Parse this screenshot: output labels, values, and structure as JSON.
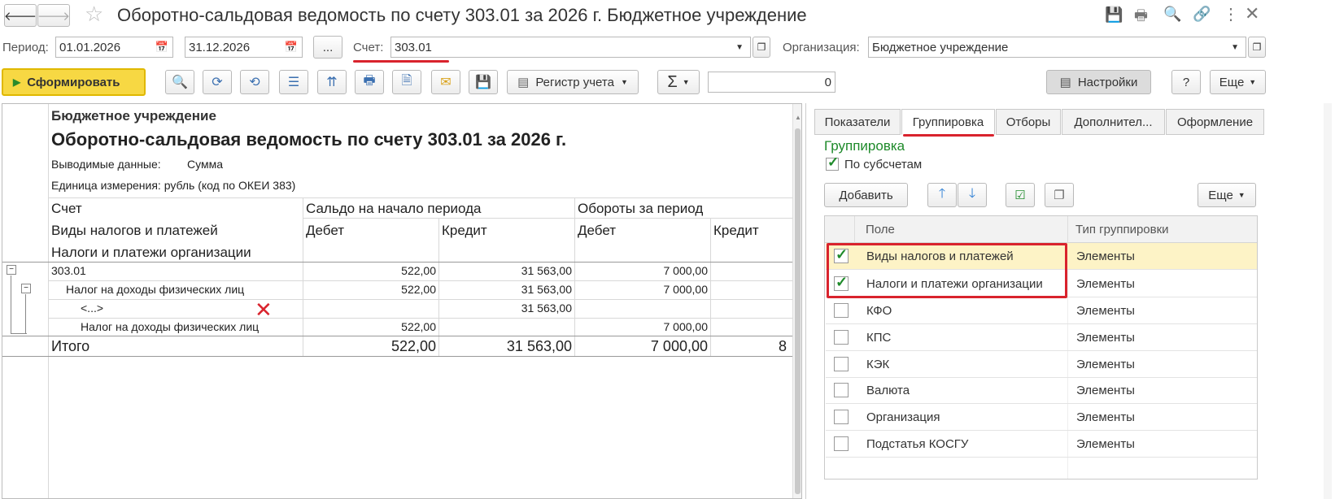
{
  "window": {
    "title": "Оборотно-сальдовая ведомость по счету 303.01 за 2026 г. Бюджетное учреждение"
  },
  "filters": {
    "period_label": "Период:",
    "date_from": "01.01.2026",
    "date_to": "31.12.2026",
    "ellipsis": "...",
    "account_label": "Счет:",
    "account_value": "303.01",
    "org_label": "Организация:",
    "org_value": "Бюджетное учреждение"
  },
  "toolbar": {
    "generate_label": "Сформировать",
    "register_label": "Регистр учета",
    "sigma_label": "Σ",
    "sum_value": "0",
    "settings_label": "Настройки",
    "help_label": "?",
    "more_label": "Еще"
  },
  "report": {
    "org": "Бюджетное учреждение",
    "title": "Оборотно-сальдовая ведомость по счету 303.01 за 2026 г.",
    "output_label": "Выводимые данные:",
    "output_value": "Сумма",
    "unit": "Единица измерения: рубль (код по ОКЕИ 383)",
    "headers": {
      "account": "Счет",
      "tax_types": "Виды налогов и платежей",
      "org_taxes": "Налоги и платежи организации",
      "opening": "Сальдо на начало периода",
      "turnover": "Обороты за период",
      "debit": "Дебет",
      "credit": "Кредит",
      "debit2": "Дебет",
      "credit2": "Кредит"
    },
    "rows": [
      {
        "name": "303.01",
        "d": "522,00",
        "c": "31 563,00",
        "td": "7 000,00"
      },
      {
        "name": "Налог на доходы физических лиц",
        "d": "522,00",
        "c": "31 563,00",
        "td": "7 000,00"
      },
      {
        "name": "<...>",
        "d": "",
        "c": "31 563,00",
        "td": ""
      },
      {
        "name": "Налог на доходы физических лиц",
        "d": "522,00",
        "c": "",
        "td": "7 000,00"
      }
    ],
    "total": {
      "name": "Итого",
      "d": "522,00",
      "c": "31 563,00",
      "td": "7 000,00",
      "tc": "8"
    }
  },
  "panel": {
    "tabs": [
      "Показатели",
      "Группировка",
      "Отборы",
      "Дополнител...",
      "Оформление"
    ],
    "group_title": "Группировка",
    "by_subaccounts": "По субсчетам",
    "add_label": "Добавить",
    "more_label": "Еще",
    "col_field": "Поле",
    "col_type": "Тип группировки",
    "rows": [
      {
        "field": "Виды налогов и платежей",
        "type": "Элементы",
        "checked": true
      },
      {
        "field": "Налоги и платежи организации",
        "type": "Элементы",
        "checked": true
      },
      {
        "field": "КФО",
        "type": "Элементы",
        "checked": false
      },
      {
        "field": "КПС",
        "type": "Элементы",
        "checked": false
      },
      {
        "field": "КЭК",
        "type": "Элементы",
        "checked": false
      },
      {
        "field": "Валюта",
        "type": "Элементы",
        "checked": false
      },
      {
        "field": "Организация",
        "type": "Элементы",
        "checked": false
      },
      {
        "field": "Подстатья КОСГУ",
        "type": "Элементы",
        "checked": false
      }
    ]
  },
  "colors": {
    "accent_green": "#1e8a2a",
    "highlight_red": "#d9232d",
    "generate_yellow": "#f7d843",
    "selected_row": "#fdf3c6"
  }
}
